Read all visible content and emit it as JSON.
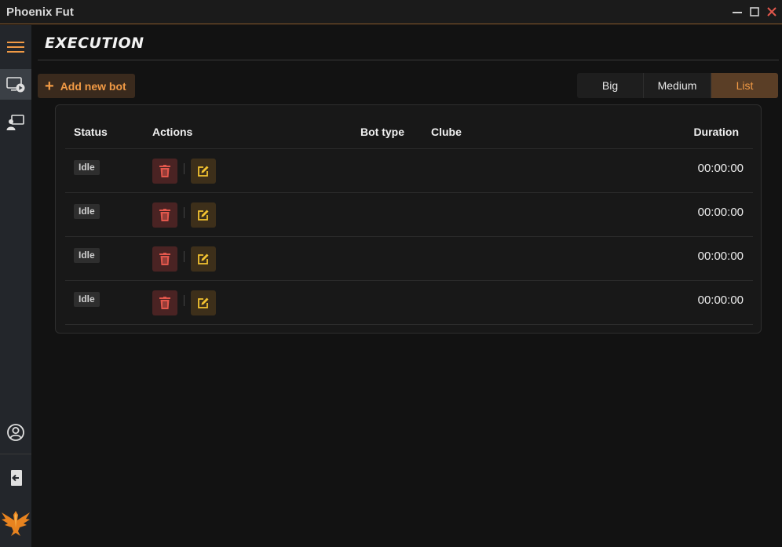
{
  "window": {
    "title": "Phoenix Fut"
  },
  "page": {
    "title": "EXECUTION"
  },
  "toolbar": {
    "add_label": "Add new bot",
    "view_options": [
      "Big",
      "Medium",
      "List"
    ],
    "selected_view": "List"
  },
  "table": {
    "headers": {
      "status": "Status",
      "actions": "Actions",
      "bot_type": "Bot type",
      "clube": "Clube",
      "duration": "Duration"
    },
    "rows": [
      {
        "status": "Idle",
        "bot_type": "",
        "clube": "",
        "duration": "00:00:00"
      },
      {
        "status": "Idle",
        "bot_type": "",
        "clube": "",
        "duration": "00:00:00"
      },
      {
        "status": "Idle",
        "bot_type": "",
        "clube": "",
        "duration": "00:00:00"
      },
      {
        "status": "Idle",
        "bot_type": "",
        "clube": "",
        "duration": "00:00:00"
      }
    ]
  },
  "colors": {
    "accent": "#f19a45",
    "delete": "#e2574c",
    "edit": "#f2c230",
    "close": "#e2574c"
  },
  "icons": {
    "sidebar": [
      "hamburger-menu-icon",
      "monitor-play-icon",
      "user-presentation-icon",
      "user-circle-icon",
      "logout-icon",
      "phoenix-logo"
    ],
    "row_actions": [
      "trash-icon",
      "edit-icon"
    ]
  }
}
